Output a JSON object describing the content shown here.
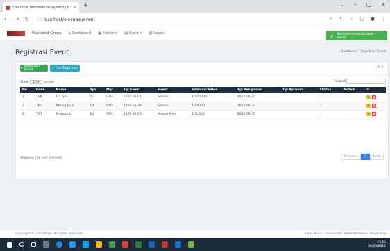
{
  "browser": {
    "tab_title": "Executive Information System | E",
    "tab_close": "×",
    "new_tab": "+",
    "url": "localhost/eis-main/event",
    "win_controls": [
      "⌄",
      "–",
      "▢",
      "×"
    ]
  },
  "app": {
    "brand": "Husband Group",
    "nav": [
      {
        "icon": "home-icon",
        "glyph": "⌂",
        "label": "Dashboard"
      },
      {
        "icon": "grid-icon",
        "glyph": "▦",
        "label": "Master ▾"
      },
      {
        "icon": "calendar-icon",
        "glyph": "▤",
        "label": "Event ▾"
      },
      {
        "icon": "report-icon",
        "glyph": "▥",
        "label": "Report"
      }
    ]
  },
  "toast": {
    "text": "Berhasil menambahkan event"
  },
  "page": {
    "title": "Registrasi Event",
    "breadcrumb": "Dashboard / Registrasi Event"
  },
  "toolbar": {
    "add_label": "Registrasi Event",
    "find_label": "Cek Registrasi",
    "tools": "– ⟳ ×"
  },
  "table": {
    "show_label": "Show",
    "show_value": "10",
    "entries_label": "entries",
    "search_label": "Search:",
    "columns": [
      "No",
      "Kode",
      "Nama",
      "Spv",
      "Mgr",
      "Tgl Event",
      "Event",
      "Estimasi Sales",
      "Tgl Pengajuan",
      "Tgl Aproval",
      "Status",
      "Noted",
      "⚙"
    ],
    "rows": [
      {
        "no": "1",
        "kode": "TVB",
        "nama": "Dr. Tyrs",
        "spv": "YD",
        "mgr": "CPO",
        "tgl_event": "2022-06-07",
        "event": "Sensor",
        "estimasi": "1.000.000",
        "tgl_pengajuan": "2022-06-30",
        "tgl_aproval": "",
        "status": "-",
        "noted": ""
      },
      {
        "no": "2",
        "kode": "TKG",
        "nama": "Bitung Jaya",
        "spv": "DA",
        "mgr": "CPO",
        "tgl_event": "2022-06-24",
        "event": "Sensor",
        "estimasi": "100.000",
        "tgl_pengajuan": "2022-06-30",
        "tgl_aproval": "",
        "status": "-",
        "noted": ""
      },
      {
        "no": "3",
        "kode": "TGT",
        "nama": "Pratapa 1",
        "spv": "DA",
        "mgr": "CPO",
        "tgl_event": "2022-06-03",
        "event": "Master Nen",
        "estimasi": "100.000",
        "tgl_pengajuan": "2022-06-30",
        "tgl_aproval": "",
        "status": "-",
        "noted": ""
      }
    ],
    "info": "Showing 1 to 3 of 3 entries",
    "prev": "Previous",
    "page": "1",
    "next": "Next"
  },
  "footer": {
    "left": "Copyright © 2022 Nagi. All rights reserved.",
    "right": "Tugas Akhir - Universitas Muhammadiyah Tangerang"
  },
  "taskbar": {
    "time": "23.25",
    "date": "06/09/2022"
  }
}
